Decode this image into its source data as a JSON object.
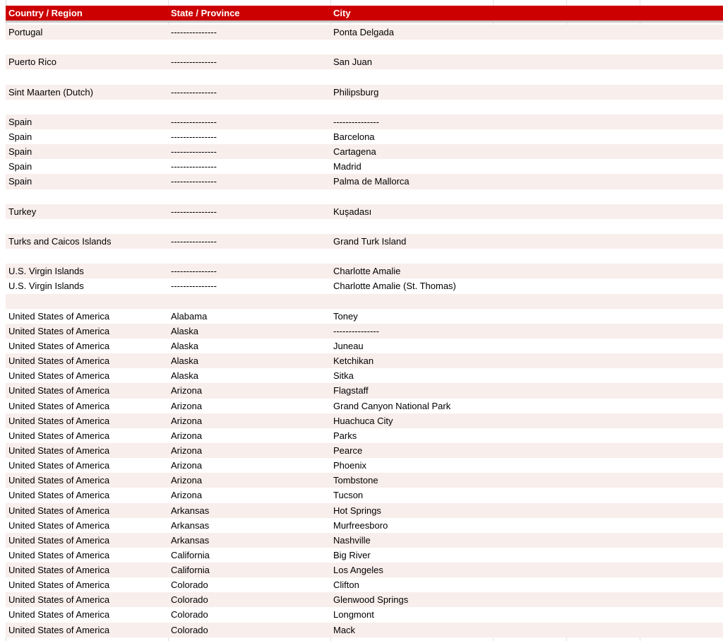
{
  "header": {
    "country": "Country / Region",
    "state": "State / Province",
    "city": "City"
  },
  "rows": [
    {
      "country": "Portugal",
      "state": "---------------",
      "city": "Ponta Delgada"
    },
    {
      "country": "",
      "state": "",
      "city": ""
    },
    {
      "country": "Puerto Rico",
      "state": "---------------",
      "city": "San Juan"
    },
    {
      "country": "",
      "state": "",
      "city": ""
    },
    {
      "country": "Sint Maarten (Dutch)",
      "state": "---------------",
      "city": "Philipsburg"
    },
    {
      "country": "",
      "state": "",
      "city": ""
    },
    {
      "country": "Spain",
      "state": "---------------",
      "city": "---------------"
    },
    {
      "country": "Spain",
      "state": "---------------",
      "city": "Barcelona"
    },
    {
      "country": "Spain",
      "state": "---------------",
      "city": "Cartagena"
    },
    {
      "country": "Spain",
      "state": "---------------",
      "city": "Madrid"
    },
    {
      "country": "Spain",
      "state": "---------------",
      "city": "Palma de Mallorca"
    },
    {
      "country": "",
      "state": "",
      "city": ""
    },
    {
      "country": "Turkey",
      "state": "---------------",
      "city": "Kuşadası"
    },
    {
      "country": "",
      "state": "",
      "city": ""
    },
    {
      "country": "Turks and Caicos Islands",
      "state": "---------------",
      "city": "Grand Turk Island"
    },
    {
      "country": "",
      "state": "",
      "city": ""
    },
    {
      "country": "U.S. Virgin Islands",
      "state": "---------------",
      "city": "Charlotte Amalie"
    },
    {
      "country": "U.S. Virgin Islands",
      "state": "---------------",
      "city": "Charlotte Amalie (St. Thomas)"
    },
    {
      "country": "",
      "state": "",
      "city": ""
    },
    {
      "country": "United States of America",
      "state": "Alabama",
      "city": "Toney"
    },
    {
      "country": "United States of America",
      "state": "Alaska",
      "city": "---------------"
    },
    {
      "country": "United States of America",
      "state": "Alaska",
      "city": "Juneau"
    },
    {
      "country": "United States of America",
      "state": "Alaska",
      "city": "Ketchikan"
    },
    {
      "country": "United States of America",
      "state": "Alaska",
      "city": "Sitka"
    },
    {
      "country": "United States of America",
      "state": "Arizona",
      "city": "Flagstaff"
    },
    {
      "country": "United States of America",
      "state": "Arizona",
      "city": "Grand Canyon National Park"
    },
    {
      "country": "United States of America",
      "state": "Arizona",
      "city": "Huachuca City"
    },
    {
      "country": "United States of America",
      "state": "Arizona",
      "city": "Parks"
    },
    {
      "country": "United States of America",
      "state": "Arizona",
      "city": "Pearce"
    },
    {
      "country": "United States of America",
      "state": "Arizona",
      "city": "Phoenix"
    },
    {
      "country": "United States of America",
      "state": "Arizona",
      "city": "Tombstone"
    },
    {
      "country": "United States of America",
      "state": "Arizona",
      "city": "Tucson"
    },
    {
      "country": "United States of America",
      "state": "Arkansas",
      "city": "Hot Springs"
    },
    {
      "country": "United States of America",
      "state": "Arkansas",
      "city": "Murfreesboro"
    },
    {
      "country": "United States of America",
      "state": "Arkansas",
      "city": "Nashville"
    },
    {
      "country": "United States of America",
      "state": "California",
      "city": "Big River"
    },
    {
      "country": "United States of America",
      "state": "California",
      "city": "Los Angeles"
    },
    {
      "country": "United States of America",
      "state": "Colorado",
      "city": "Clifton"
    },
    {
      "country": "United States of America",
      "state": "Colorado",
      "city": "Glenwood Springs"
    },
    {
      "country": "United States of America",
      "state": "Colorado",
      "city": "Longmont"
    },
    {
      "country": "United States of America",
      "state": "Colorado",
      "city": "Mack"
    }
  ],
  "colors": {
    "header_bg": "#cc0000",
    "header_text": "#ffffff",
    "row_shade": "#f8eeec",
    "row_plain": "#ffffff"
  }
}
